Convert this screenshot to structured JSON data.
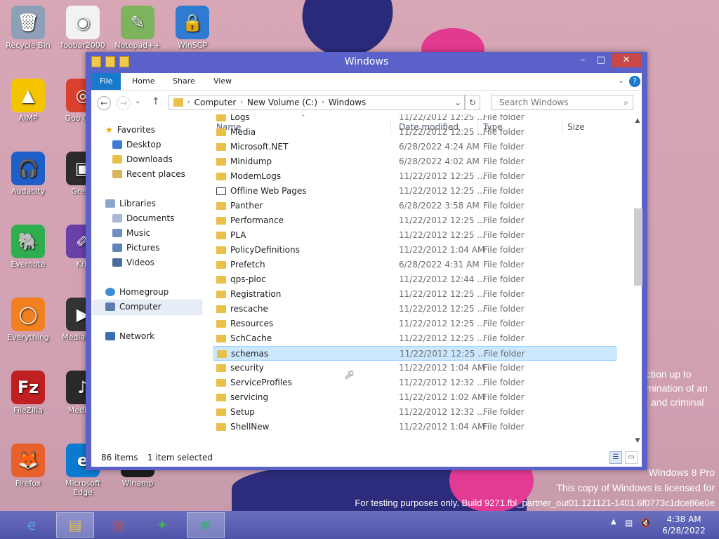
{
  "desktop_icons": [
    {
      "label": "Recycle Bin",
      "icon": "recycle-bin-icon",
      "glyph": "🗑"
    },
    {
      "label": "foobar2000",
      "icon": "foobar2000-icon",
      "glyph": "◉"
    },
    {
      "label": "Notepad++",
      "icon": "notepadpp-icon",
      "glyph": "✎"
    },
    {
      "label": "WinSCP",
      "icon": "winscp-icon",
      "glyph": "🔒"
    },
    {
      "label": "AIMP",
      "icon": "aimp-icon",
      "glyph": "▲"
    },
    {
      "label": "Goo Chro",
      "icon": "chrome-icon",
      "glyph": "◎"
    },
    {
      "label": "Audacity",
      "icon": "audacity-icon",
      "glyph": "🎧"
    },
    {
      "label": "Green",
      "icon": "greenshot-icon",
      "glyph": "▣"
    },
    {
      "label": "Evernote",
      "icon": "evernote-icon",
      "glyph": "🐘"
    },
    {
      "label": "Krit",
      "icon": "krita-icon",
      "glyph": "✐"
    },
    {
      "label": "Everything",
      "icon": "everything-icon",
      "glyph": "◯"
    },
    {
      "label": "Media Clas",
      "icon": "media-player-classic-icon",
      "glyph": "▶"
    },
    {
      "label": "FileZilla",
      "icon": "filezilla-icon",
      "glyph": "Fz"
    },
    {
      "label": "MediaM",
      "icon": "mediamonkey-icon",
      "glyph": "♪"
    },
    {
      "label": "Firefox",
      "icon": "firefox-icon",
      "glyph": "🦊"
    },
    {
      "label": "Microsoft Edge",
      "icon": "edge-icon",
      "glyph": "e"
    },
    {
      "label": "Winamp",
      "icon": "winamp-icon",
      "glyph": "⚡"
    }
  ],
  "watermark": {
    "partial1": "ction up to",
    "partial2": "mination of an",
    "partial3": "l and criminal",
    "os": "Windows 8 Pro",
    "license": "This copy of Windows is licensed for",
    "build": "For testing purposes only. Build 9271.fbl_partner_out01.121121-1401.6f0773c1dce86e0e"
  },
  "window": {
    "title": "Windows",
    "controls": {
      "minimize": "–",
      "maximize": "□",
      "close": "✕"
    },
    "ribbon": {
      "tabs": [
        "File",
        "Home",
        "Share",
        "View"
      ],
      "collapse": "⌄",
      "help": "?"
    },
    "nav": {
      "back": "←",
      "forward": "→",
      "recent": "⌄",
      "up": "↑",
      "refresh": "↻"
    },
    "address": {
      "crumbs": [
        "Computer",
        "New Volume (C:)",
        "Windows"
      ],
      "sep": "›",
      "dropdown": "⌄"
    },
    "search": {
      "placeholder": "Search Windows",
      "icon": "⌕"
    },
    "nav_pane": {
      "favorites": "Favorites",
      "favorites_items": [
        "Desktop",
        "Downloads",
        "Recent places"
      ],
      "libraries": "Libraries",
      "libraries_items": [
        "Documents",
        "Music",
        "Pictures",
        "Videos"
      ],
      "homegroup": "Homegroup",
      "computer": "Computer",
      "network": "Network"
    },
    "columns": {
      "name": "Name",
      "date": "Date modified",
      "type": "Type",
      "size": "Size"
    },
    "files": [
      {
        "name": "Logs",
        "date": "11/22/2012 12:25 ...",
        "type": "File folder"
      },
      {
        "name": "Media",
        "date": "11/22/2012 12:25 ...",
        "type": "File folder"
      },
      {
        "name": "Microsoft.NET",
        "date": "6/28/2022 4:24 AM",
        "type": "File folder"
      },
      {
        "name": "Minidump",
        "date": "6/28/2022 4:02 AM",
        "type": "File folder"
      },
      {
        "name": "ModemLogs",
        "date": "11/22/2012 12:25 ...",
        "type": "File folder"
      },
      {
        "name": "Offline Web Pages",
        "date": "11/22/2012 12:25 ...",
        "type": "File folder"
      },
      {
        "name": "Panther",
        "date": "6/28/2022 3:58 AM",
        "type": "File folder"
      },
      {
        "name": "Performance",
        "date": "11/22/2012 12:25 ...",
        "type": "File folder"
      },
      {
        "name": "PLA",
        "date": "11/22/2012 12:25 ...",
        "type": "File folder"
      },
      {
        "name": "PolicyDefinitions",
        "date": "11/22/2012 1:04 AM",
        "type": "File folder"
      },
      {
        "name": "Prefetch",
        "date": "6/28/2022 4:31 AM",
        "type": "File folder"
      },
      {
        "name": "qps-ploc",
        "date": "11/22/2012 12:44 ...",
        "type": "File folder"
      },
      {
        "name": "Registration",
        "date": "11/22/2012 12:25 ...",
        "type": "File folder"
      },
      {
        "name": "rescache",
        "date": "11/22/2012 12:25 ...",
        "type": "File folder"
      },
      {
        "name": "Resources",
        "date": "11/22/2012 12:25 ...",
        "type": "File folder"
      },
      {
        "name": "SchCache",
        "date": "11/22/2012 12:25 ...",
        "type": "File folder"
      },
      {
        "name": "schemas",
        "date": "11/22/2012 12:25 ...",
        "type": "File folder"
      },
      {
        "name": "security",
        "date": "11/22/2012 1:04 AM",
        "type": "File folder"
      },
      {
        "name": "ServiceProfiles",
        "date": "11/22/2012 12:32 ...",
        "type": "File folder"
      },
      {
        "name": "servicing",
        "date": "11/22/2012 1:02 AM",
        "type": "File folder"
      },
      {
        "name": "Setup",
        "date": "11/22/2012 12:32 ...",
        "type": "File folder"
      },
      {
        "name": "ShellNew",
        "date": "11/22/2012 1:04 AM",
        "type": "File folder"
      }
    ],
    "selected_file": "schemas",
    "status": {
      "count": "86 items",
      "selection": "1 item selected"
    }
  },
  "taskbar": {
    "apps": [
      {
        "icon": "internet-explorer-icon",
        "glyph": "e"
      },
      {
        "icon": "file-explorer-icon",
        "glyph": "▤"
      },
      {
        "icon": "chrome-icon",
        "glyph": "◎"
      },
      {
        "icon": "network-app-icon",
        "glyph": "✦"
      },
      {
        "icon": "spotify-icon",
        "glyph": "≋"
      }
    ],
    "time": "4:38 AM",
    "date": "6/28/2022"
  }
}
